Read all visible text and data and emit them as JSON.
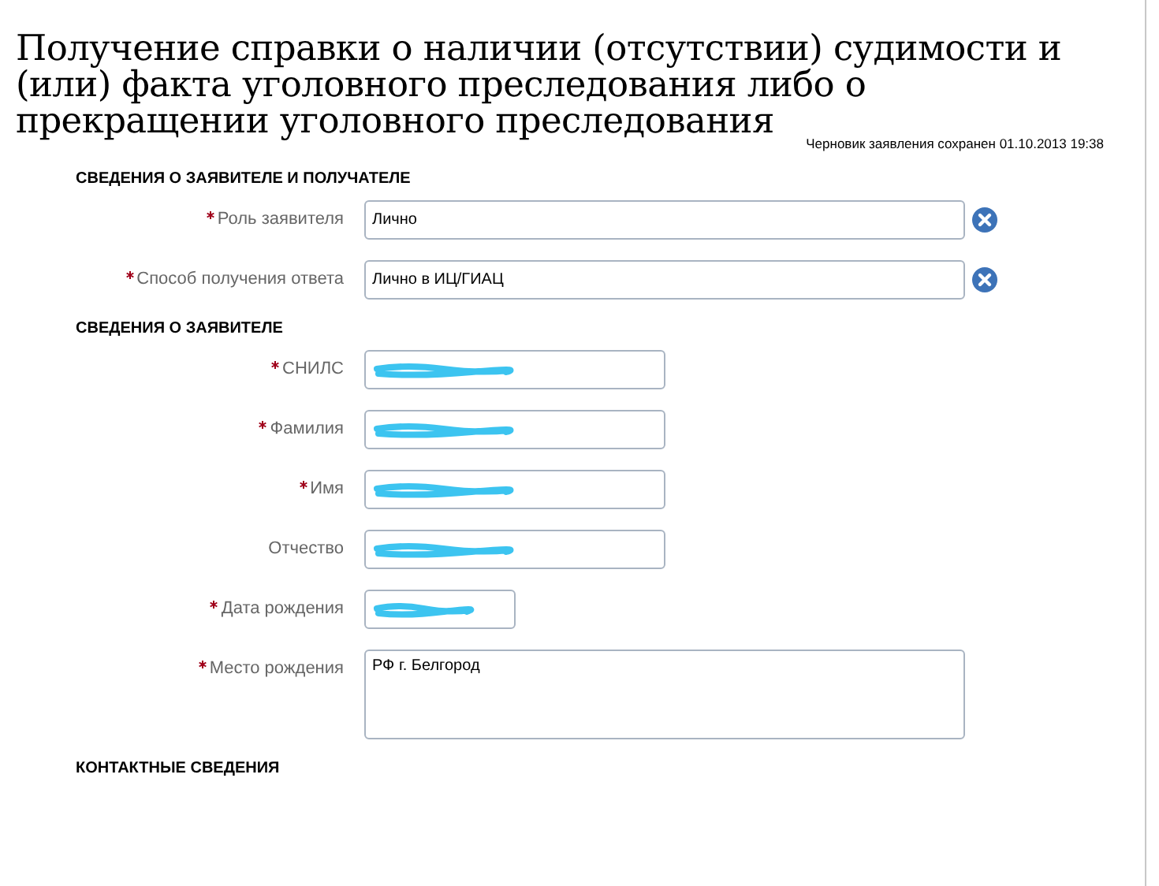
{
  "title": "Получение справки о наличии (отсутствии) судимости и (или) факта уголовного преследования либо о прекращении уголовного преследования",
  "draft_note": "Черновик заявления сохранен 01.10.2013 19:38",
  "sections": [
    {
      "heading": "СВЕДЕНИЯ О ЗАЯВИТЕЛЕ И ПОЛУЧАТЕЛЕ",
      "fields": [
        {
          "label": "Роль заявителя",
          "required": true,
          "kind": "select",
          "value": "Лично"
        },
        {
          "label": "Способ получения ответа",
          "required": true,
          "kind": "select",
          "value": "Лично в ИЦ/ГИАЦ"
        }
      ]
    },
    {
      "heading": "СВЕДЕНИЯ О ЗАЯВИТЕЛЕ",
      "fields": [
        {
          "label": "СНИЛС",
          "required": true,
          "kind": "text",
          "redacted": true
        },
        {
          "label": "Фамилия",
          "required": true,
          "kind": "text",
          "redacted": true
        },
        {
          "label": "Имя",
          "required": true,
          "kind": "text",
          "redacted": true
        },
        {
          "label": "Отчество",
          "required": false,
          "kind": "text",
          "redacted": true
        },
        {
          "label": "Дата рождения",
          "required": true,
          "kind": "date",
          "redacted": true
        },
        {
          "label": "Место рождения",
          "required": true,
          "kind": "textarea",
          "value": "РФ г. Белгород"
        }
      ]
    },
    {
      "heading": "КОНТАКТНЫЕ СВЕДЕНИЯ"
    }
  ]
}
